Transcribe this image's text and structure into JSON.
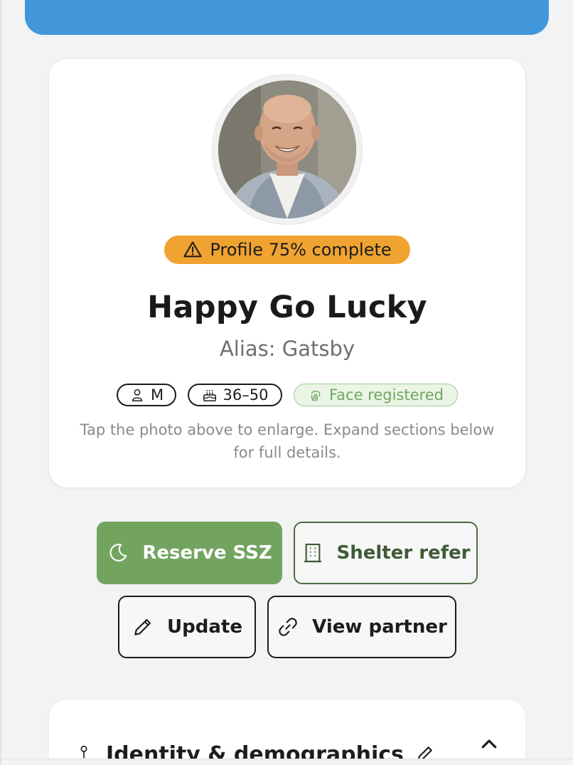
{
  "profile": {
    "completion_badge": "Profile 75% complete",
    "completion_percent": 75,
    "name": "Happy Go Lucky",
    "alias": "Alias: Gatsby",
    "chips": {
      "gender": "M",
      "age_range": "36–50",
      "face_status": "Face registered"
    },
    "hint": "Tap the photo above to enlarge. Expand sections below for full details."
  },
  "actions": {
    "reserve_label": "Reserve SSZ",
    "shelter_label": "Shelter refer",
    "update_label": "Update",
    "partner_label": "View partner"
  },
  "section": {
    "title": "Identity & demographics"
  },
  "colors": {
    "banner": "#4197da",
    "badge_warning": "#f0a330",
    "primary_green": "#73a45f",
    "face_green": "#6fa85f"
  },
  "icons": {
    "badge": "warning-triangle-icon",
    "gender": "person-icon",
    "age": "cake-icon",
    "face": "fingerprint-icon",
    "reserve": "moon-icon",
    "shelter": "building-icon",
    "update": "pencil-icon",
    "partner": "link-icon",
    "section": "pin-icon",
    "section_edit": "pencil-icon",
    "section_toggle": "chevron-up-icon"
  }
}
